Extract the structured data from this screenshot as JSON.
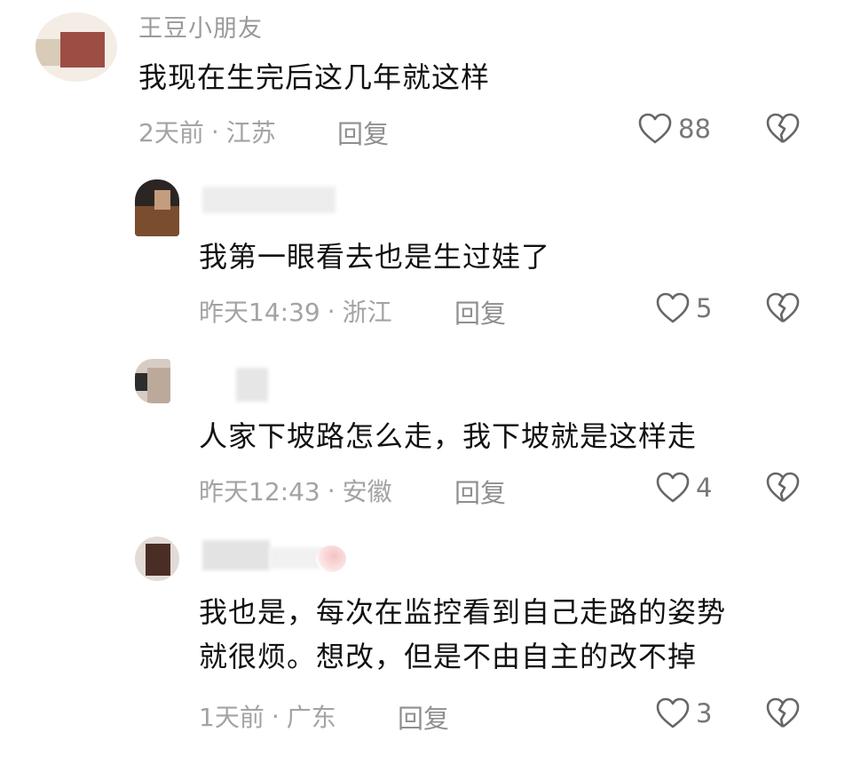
{
  "comments": [
    {
      "username": "王豆小朋友",
      "text_lines": [
        "我现在生完后这几年就这样"
      ],
      "time": "2天前",
      "location": "江苏",
      "reply_label": "回复",
      "likes": "88"
    },
    {
      "username": "",
      "text_lines": [
        "我第一眼看去也是生过娃了"
      ],
      "time": "昨天14:39",
      "location": "浙江",
      "reply_label": "回复",
      "likes": "5"
    },
    {
      "username": "",
      "text_lines": [
        "人家下坡路怎么走，我下坡就是这样走"
      ],
      "time": "昨天12:43",
      "location": "安徽",
      "reply_label": "回复",
      "likes": "4"
    },
    {
      "username": "",
      "text_lines": [
        "我也是，每次在监控看到自己走路的姿势",
        "就很烦。想改，但是不由自主的改不掉"
      ],
      "time": "1天前",
      "location": "广东",
      "reply_label": "回复",
      "likes": "3"
    }
  ],
  "meta_separator": "·",
  "icons": {
    "like": "heart-outline-icon",
    "dislike": "broken-heart-icon"
  },
  "colors": {
    "text": "#111111",
    "meta": "#a3a3a3",
    "icon": "#666666"
  }
}
